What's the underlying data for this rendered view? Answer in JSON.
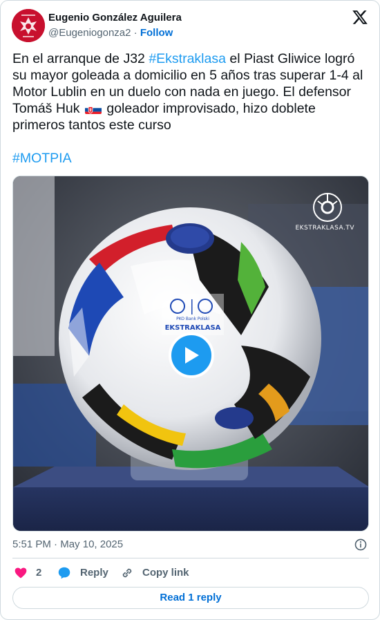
{
  "author": {
    "name": "Eugenio González Aguilera",
    "handle": "@Eugeniogonza2",
    "separator": "·",
    "follow_label": "Follow",
    "avatar_icon": "red-crest-avatar"
  },
  "brand": {
    "icon": "x-logo-icon"
  },
  "tweet": {
    "text_part1": "En el arranque de J32 ",
    "hashtag1": "#Ekstraklasa",
    "text_part2": " el Piast Gliwice logró su mayor goleada a domicilio en 5 años tras superar 1-4 al Motor Lublin en un duelo con nada en juego. El defensor Tomáš Huk ",
    "flag_icon": "slovakia-flag-icon",
    "text_part3": " goleador improvisado, hizo doblete primeros tantos este curso",
    "hashtag2": "#MOTPIA"
  },
  "media": {
    "watermark": "EKSTRAKLASA.TV",
    "ball_brand": "EKSTRAKLASA",
    "ball_sponsor": "PKO Bank Polski",
    "play_icon": "play-icon"
  },
  "meta": {
    "time": "5:51 PM",
    "separator": "·",
    "date": "May 10, 2025",
    "info_icon": "info-icon"
  },
  "actions": {
    "like_count": "2",
    "reply_label": "Reply",
    "copy_label": "Copy link"
  },
  "read_replies_label": "Read 1 reply",
  "colors": {
    "accent": "#1d9bf0",
    "link": "#006fd6",
    "like": "#f91880",
    "muted": "#536471"
  }
}
